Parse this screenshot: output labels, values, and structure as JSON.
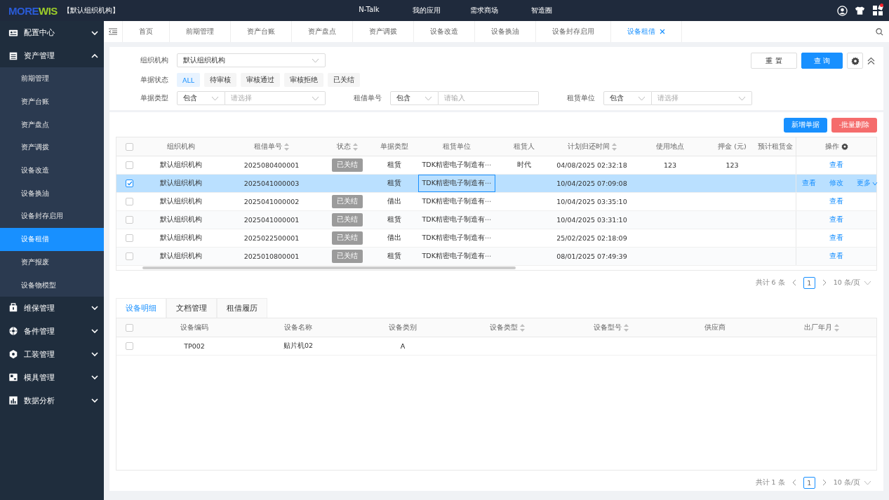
{
  "header": {
    "logo": {
      "first": "MORE",
      "second": "WIS"
    },
    "org": "【默认组织机构】",
    "nav": [
      "N-Talk",
      "我的应用",
      "需求商场",
      "智造圈"
    ]
  },
  "sidebar": {
    "groups": [
      {
        "label": "配置中心",
        "expanded": false
      },
      {
        "label": "资产管理",
        "expanded": true,
        "children": [
          {
            "label": "前期管理",
            "selected": false
          },
          {
            "label": "资产台账",
            "selected": false
          },
          {
            "label": "资产盘点",
            "selected": false
          },
          {
            "label": "资产调拨",
            "selected": false
          },
          {
            "label": "设备改造",
            "selected": false
          },
          {
            "label": "设备换油",
            "selected": false
          },
          {
            "label": "设备封存启用",
            "selected": false
          },
          {
            "label": "设备租借",
            "selected": true
          },
          {
            "label": "资产报废",
            "selected": false
          },
          {
            "label": "设备物模型",
            "selected": false
          }
        ]
      },
      {
        "label": "维保管理",
        "expanded": false
      },
      {
        "label": "备件管理",
        "expanded": false
      },
      {
        "label": "工装管理",
        "expanded": false
      },
      {
        "label": "模具管理",
        "expanded": false
      },
      {
        "label": "数据分析",
        "expanded": false
      }
    ]
  },
  "tabs": [
    {
      "label": "首页",
      "selected": false
    },
    {
      "label": "前期管理",
      "selected": false
    },
    {
      "label": "资产台账",
      "selected": false
    },
    {
      "label": "资产盘点",
      "selected": false
    },
    {
      "label": "资产调拨",
      "selected": false
    },
    {
      "label": "设备改造",
      "selected": false
    },
    {
      "label": "设备换油",
      "selected": false
    },
    {
      "label": "设备封存启用",
      "selected": false
    },
    {
      "label": "设备租借",
      "selected": true
    }
  ],
  "filters": {
    "org_label": "组织机构",
    "org_value": "默认组织机构",
    "status_label": "单据状态",
    "statuses": [
      {
        "label": "ALL",
        "selected": true
      },
      {
        "label": "待审核",
        "selected": false
      },
      {
        "label": "审核通过",
        "selected": false
      },
      {
        "label": "审核拒绝",
        "selected": false
      },
      {
        "label": "已关结",
        "selected": false
      }
    ],
    "fields": [
      {
        "label": "单据类型",
        "op": "包含",
        "placeholder": "请选择",
        "kind": "select"
      },
      {
        "label": "租借单号",
        "op": "包含",
        "placeholder": "请输入",
        "kind": "input"
      },
      {
        "label": "租赁单位",
        "op": "包含",
        "placeholder": "请选择",
        "kind": "select"
      }
    ],
    "reset": "重 置",
    "query": "查 询"
  },
  "actions": {
    "add": "新增单据",
    "delete": "-批量删除"
  },
  "table": {
    "all_checked": false,
    "columns": [
      {
        "label": "组织机构",
        "sortable": false
      },
      {
        "label": "租借单号",
        "sortable": true
      },
      {
        "label": "状态",
        "sortable": true
      },
      {
        "label": "单据类型",
        "sortable": false
      },
      {
        "label": "租赁单位",
        "sortable": false
      },
      {
        "label": "租赁人",
        "sortable": false
      },
      {
        "label": "计划归还时间",
        "sortable": true
      },
      {
        "label": "使用地点",
        "sortable": false
      },
      {
        "label": "押金 (元)",
        "sortable": false
      },
      {
        "label": "预计租赁金",
        "sortable": false
      },
      {
        "label": "操作",
        "sortable": false
      }
    ],
    "rows": [
      {
        "checked": false,
        "selected": false,
        "cells": [
          "默认组织机构",
          "2025080400001",
          "已关结",
          "租赁",
          "TDK精密电子制造有⋯",
          "时代",
          "04/08/2025 02:32:18",
          "123",
          "123",
          ""
        ],
        "ops": [
          "查看"
        ]
      },
      {
        "checked": true,
        "selected": true,
        "cells": [
          "默认组织机构",
          "2025041000003",
          "",
          "租赁",
          "TDK精密电子制造有⋯",
          "",
          "10/04/2025 07:09:08",
          "",
          "",
          ""
        ],
        "ops": [
          "查看",
          "修改",
          "更多"
        ]
      },
      {
        "checked": false,
        "selected": false,
        "cells": [
          "默认组织机构",
          "2025041000002",
          "已关结",
          "借出",
          "TDK精密电子制造有⋯",
          "",
          "10/04/2025 03:35:10",
          "",
          "",
          ""
        ],
        "ops": [
          "查看"
        ]
      },
      {
        "checked": false,
        "selected": false,
        "cells": [
          "默认组织机构",
          "2025041000001",
          "已关结",
          "租赁",
          "TDK精密电子制造有⋯",
          "",
          "10/04/2025 03:31:10",
          "",
          "",
          ""
        ],
        "ops": [
          "查看"
        ]
      },
      {
        "checked": false,
        "selected": false,
        "cells": [
          "默认组织机构",
          "2025022500001",
          "已关结",
          "借出",
          "TDK精密电子制造有⋯",
          "",
          "25/02/2025 02:18:09",
          "",
          "",
          ""
        ],
        "ops": [
          "查看"
        ]
      },
      {
        "checked": false,
        "selected": false,
        "cells": [
          "默认组织机构",
          "2025010800001",
          "已关结",
          "租赁",
          "TDK精密电子制造有⋯",
          "",
          "08/01/2025 07:49:39",
          "",
          "",
          ""
        ],
        "ops": [
          "查看"
        ]
      }
    ],
    "pagination": {
      "total": "共计 6 条",
      "page": "1",
      "size": "10 条/页"
    }
  },
  "detail": {
    "tabs": [
      {
        "label": "设备明细",
        "selected": true
      },
      {
        "label": "文档管理",
        "selected": false
      },
      {
        "label": "租借履历",
        "selected": false
      }
    ],
    "all_checked": false,
    "columns": [
      {
        "label": "设备编码",
        "sortable": false
      },
      {
        "label": "设备名称",
        "sortable": false
      },
      {
        "label": "设备类别",
        "sortable": false
      },
      {
        "label": "设备类型",
        "sortable": true
      },
      {
        "label": "设备型号",
        "sortable": true
      },
      {
        "label": "供应商",
        "sortable": false
      },
      {
        "label": "出厂年月",
        "sortable": true
      }
    ],
    "rows": [
      {
        "checked": false,
        "cells": [
          "TP002",
          "贴片机02",
          "A",
          "",
          "",
          "",
          ""
        ]
      }
    ],
    "pagination": {
      "total": "共计 1 条",
      "page": "1",
      "size": "10 条/页"
    }
  }
}
